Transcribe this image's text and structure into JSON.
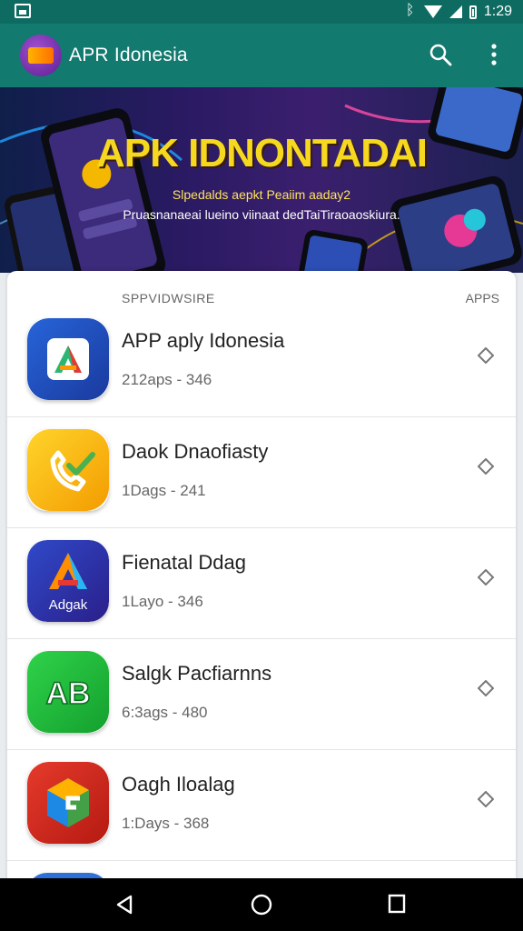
{
  "status_bar": {
    "time": "1:29",
    "icons": [
      "gallery-icon",
      "bluetooth-icon",
      "wifi-icon",
      "signal-icon",
      "battery-icon"
    ]
  },
  "app_bar": {
    "title": "APR Idonesia",
    "icons": [
      "search-icon",
      "more-vert-icon"
    ]
  },
  "banner": {
    "title": "APK IDNONTADAI",
    "subtitle_1": "Slpedalds aepkt Peaiim aaday2",
    "subtitle_2": "Pruasnanaeai lueino viinaat dedTaiTiraoaoskiura."
  },
  "list": {
    "header_left": "SPPVIDWSIRE",
    "header_right": "APPS",
    "items": [
      {
        "name": "APP aply Idonesia",
        "meta": "212aps - 346",
        "icon": "a-letter-icon",
        "color": "#1e4db7"
      },
      {
        "name": "Daok Dnaofiasty",
        "meta": "1Dags - 241",
        "icon": "phone-check-icon",
        "color": "#f7b500"
      },
      {
        "name": "Fienatal Ddag",
        "meta": "1Layo - 346",
        "icon": "a-triangle-icon",
        "color": "#2a3bb0",
        "icon_text": "Adgak"
      },
      {
        "name": "Salgk Pacfiarnns",
        "meta": "6:3ags - 480",
        "icon": "ab-letters-icon",
        "color": "#1ebc3a",
        "icon_text": "AB"
      },
      {
        "name": "Oagh Iloalag",
        "meta": "1:Days - 368",
        "icon": "g-cube-icon",
        "color": "#d62a1f"
      }
    ]
  },
  "nav_bar": {
    "icons": [
      "back-icon",
      "home-icon",
      "recents-icon"
    ]
  }
}
